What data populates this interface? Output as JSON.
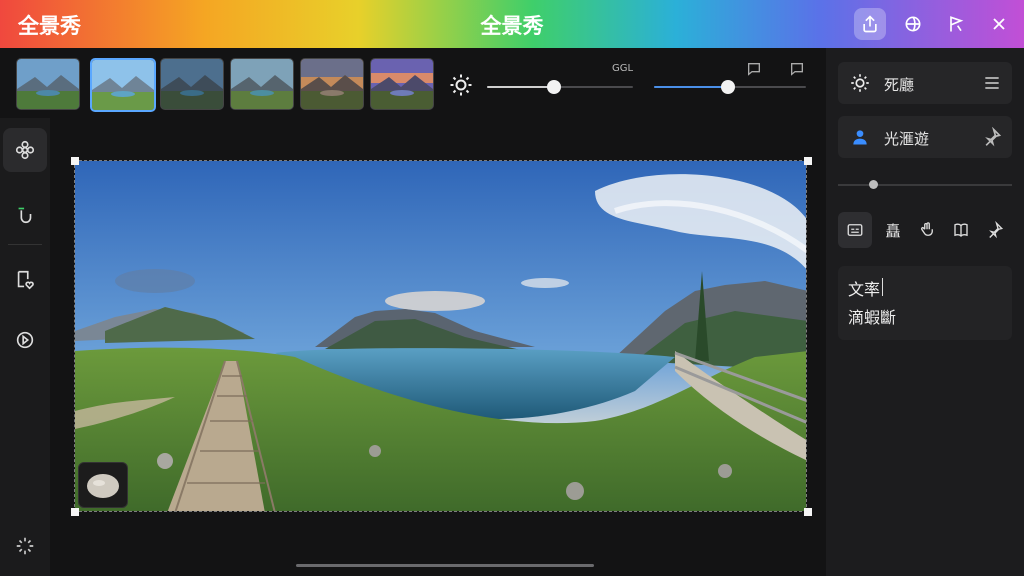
{
  "window": {
    "app_name": "全景秀",
    "title": "全景秀",
    "buttons": [
      {
        "name": "share-button",
        "icon": "share-icon"
      },
      {
        "name": "rotate-view-button",
        "icon": "rotate-icon"
      },
      {
        "name": "flag-button",
        "icon": "flag-icon"
      },
      {
        "name": "close-button",
        "icon": "close-icon"
      }
    ]
  },
  "left_toolbar": {
    "items": [
      {
        "name": "filters-tool",
        "icon": "flower-icon",
        "active": true
      },
      {
        "name": "undo-tool",
        "icon": "undo-icon",
        "active": false
      },
      {
        "name": "tag-tool",
        "icon": "tag-heart-icon",
        "active": false
      },
      {
        "name": "play-tool",
        "icon": "play-circle-icon",
        "active": false
      },
      {
        "name": "settings-tool",
        "icon": "sparkle-icon",
        "active": false
      }
    ]
  },
  "presets": {
    "count": 6,
    "selected_index": 1
  },
  "top_controls": {
    "brightness_icon": "sun-icon",
    "label": "GGL",
    "slider1_value": 0.46,
    "slider2_value": 0.49,
    "icons": [
      "comment-icon",
      "comment-icon"
    ]
  },
  "right_panel": {
    "card1": {
      "label": "死廳",
      "icon": "sun-icon",
      "right_icon": "menu-icon"
    },
    "card2": {
      "label": "光滙遊",
      "icon": "person-icon",
      "right_icon": "pin-icon"
    },
    "slider_value": 0.2,
    "tools": [
      {
        "name": "subtitle-tool",
        "icon": "caption-icon",
        "active": true
      },
      {
        "name": "text-tool",
        "text": "矗",
        "active": false
      },
      {
        "name": "brush-tool",
        "icon": "hand-icon",
        "active": false
      },
      {
        "name": "bookmark-tool",
        "icon": "book-icon",
        "active": false
      },
      {
        "name": "pin-tool",
        "icon": "pin-icon",
        "active": false
      }
    ],
    "text_lines": [
      "文率",
      "滴蝦斷"
    ]
  },
  "colors": {
    "accent": "#5aa7ff",
    "person_icon": "#3a8dff"
  }
}
